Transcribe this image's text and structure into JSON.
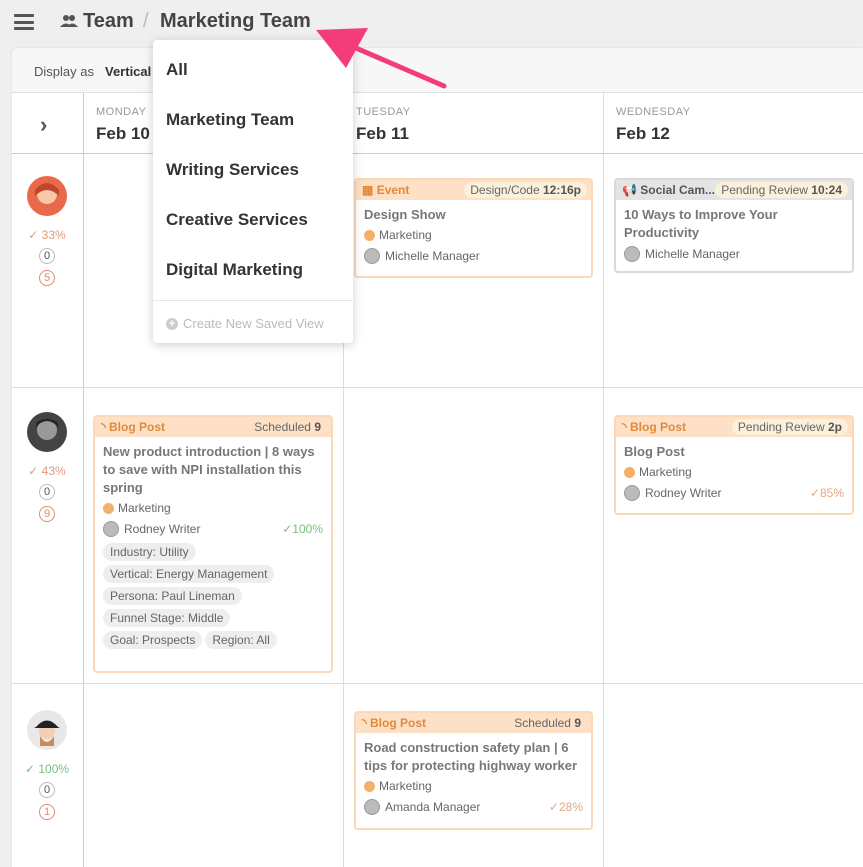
{
  "header": {
    "team_label": "Team",
    "separator": "/",
    "current_view": "Marketing Team"
  },
  "display_bar": {
    "label": "Display as",
    "value": "Vertical"
  },
  "dropdown": {
    "items": [
      "All",
      "Marketing Team",
      "Writing Services",
      "Creative Services",
      "Digital Marketing"
    ],
    "create_label": "Create New Saved View"
  },
  "days": [
    {
      "name": "MONDAY",
      "date": "Feb 10"
    },
    {
      "name": "TUESDAY",
      "date": "Feb 11"
    },
    {
      "name": "WEDNESDAY",
      "date": "Feb 12"
    }
  ],
  "people": [
    {
      "pct": "33%",
      "count_a": "0",
      "count_b": "5"
    },
    {
      "pct": "43%",
      "count_a": "0",
      "count_b": "9"
    },
    {
      "pct": "100%",
      "count_a": "0",
      "count_b": "1"
    }
  ],
  "cards": {
    "event": {
      "type": "Event",
      "status": "Design/Code",
      "time": "12:16p",
      "title": "Design Show",
      "category": "Marketing",
      "person": "Michelle Manager"
    },
    "social": {
      "type": "Social Cam...",
      "status": "Pending Review",
      "time": "10:24",
      "title": "10 Ways to Improve Your Productivity",
      "person": "Michelle Manager"
    },
    "blog1": {
      "type": "Blog Post",
      "status": "Scheduled",
      "time": "9",
      "title": "New product introduction | 8 ways to save with NPI installation this spring",
      "category": "Marketing",
      "person": "Rodney Writer",
      "progress": "100%",
      "tags": [
        "Industry: Utility",
        "Vertical: Energy Management",
        "Persona: Paul Lineman",
        "Funnel Stage: Middle",
        "Goal: Prospects",
        "Region: All"
      ]
    },
    "blog2": {
      "type": "Blog Post",
      "status": "Pending Review",
      "time": "2p",
      "title": "Blog Post",
      "category": "Marketing",
      "person": "Rodney Writer",
      "progress": "85%"
    },
    "blog3": {
      "type": "Blog Post",
      "status": "Scheduled",
      "time": "9",
      "title": "Road construction safety plan | 6 tips for protecting highway worker",
      "category": "Marketing",
      "person": "Amanda Manager",
      "progress": "28%"
    }
  },
  "colors": {
    "accent_orange": "#e08a3c",
    "card_header": "#fde0c5",
    "arrow_pink": "#f23d7a"
  }
}
